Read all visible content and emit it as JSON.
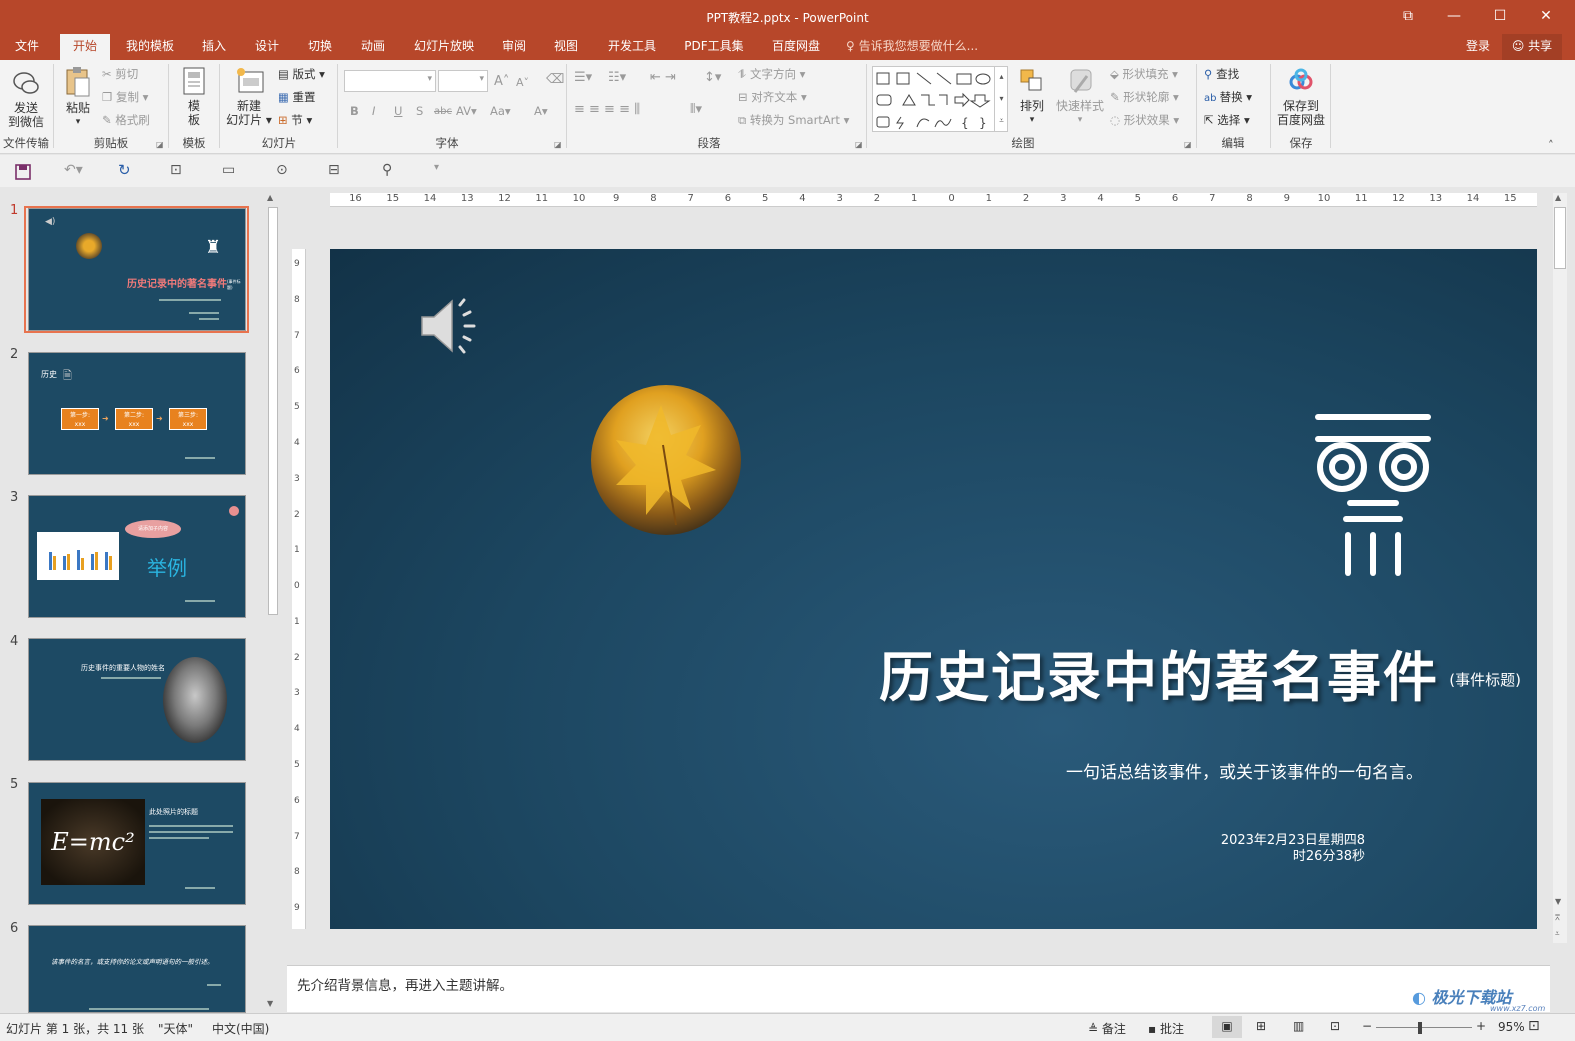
{
  "window": {
    "title": "PPT教程2.pptx - PowerPoint",
    "controls": [
      "⧉",
      "—",
      "☐",
      "✕"
    ]
  },
  "tabs": {
    "file": "文件",
    "items": [
      "开始",
      "我的模板",
      "插入",
      "设计",
      "切换",
      "动画",
      "幻灯片放映",
      "审阅",
      "视图",
      "开发工具",
      "PDF工具集",
      "百度网盘"
    ],
    "tellme": "告诉我您想要做什么...",
    "login": "登录",
    "share": "共享"
  },
  "ribbon": {
    "wechat": {
      "label": "发送到微信",
      "line1": "发送",
      "line2": "到微信",
      "group": "文件传输"
    },
    "clipboard": {
      "paste": "粘贴",
      "cut": "剪切",
      "copy": "复制",
      "painter": "格式刷",
      "group": "剪贴板"
    },
    "template": {
      "label1": "模",
      "label2": "板",
      "group": "模板"
    },
    "slides": {
      "new1": "新建",
      "new2": "幻灯片",
      "layout": "版式",
      "reset": "重置",
      "section": "节",
      "group": "幻灯片"
    },
    "font": {
      "group": "字体",
      "bold": "B",
      "italic": "I",
      "underline": "U",
      "shadow": "S",
      "strike": "abc",
      "spacing": "AV",
      "case": "Aa",
      "grow": "A",
      "shrink": "A",
      "color": "A"
    },
    "paragraph": {
      "textdir": "文字方向",
      "align": "对齐文本",
      "smartart": "转换为 SmartArt",
      "group": "段落"
    },
    "drawing": {
      "arrange": "排列",
      "quickstyle": "快速样式",
      "fill": "形状填充",
      "outline": "形状轮廓",
      "effects": "形状效果",
      "group": "绘图"
    },
    "editing": {
      "find": "查找",
      "replace": "替换",
      "select": "选择",
      "group": "编辑"
    },
    "save": {
      "line1": "保存到",
      "line2": "百度网盘",
      "group": "保存"
    }
  },
  "thumbnails": [
    {
      "num": "1",
      "title": "历史记录中的著名事件",
      "tag": "(事件标题)"
    },
    {
      "num": "2",
      "label": "历史",
      "steps": [
        "第一步:",
        "第二步:",
        "第三步:"
      ],
      "sub": "xxx"
    },
    {
      "num": "3",
      "bubble": "请添加子内容",
      "word": "举例"
    },
    {
      "num": "4",
      "title": "历史事件的重要人物的姓名"
    },
    {
      "num": "5",
      "title": "此处照片的标题",
      "formula": "E=mc²"
    },
    {
      "num": "6",
      "quote": "该事件的名言，或支持你的论文或声明语句的一般引述。"
    }
  ],
  "ruler": {
    "h": [
      "16",
      "15",
      "14",
      "13",
      "12",
      "11",
      "10",
      "9",
      "8",
      "7",
      "6",
      "5",
      "4",
      "3",
      "2",
      "1",
      "0",
      "1",
      "2",
      "3",
      "4",
      "5",
      "6",
      "7",
      "8",
      "9",
      "10",
      "11",
      "12",
      "13",
      "14",
      "15",
      "16"
    ],
    "v": [
      "9",
      "8",
      "7",
      "6",
      "5",
      "4",
      "3",
      "2",
      "1",
      "0",
      "1",
      "2",
      "3",
      "4",
      "5",
      "6",
      "7",
      "8",
      "9"
    ]
  },
  "slide": {
    "title": "历史记录中的著名事件",
    "tag": "(事件标题)",
    "subtitle": "一句话总结该事件，或关于该事件的一句名言。",
    "date_line1": "2023年2月23日星期四8",
    "date_line2": "时26分38秒"
  },
  "notes": {
    "text": "先介绍背景信息，再进入主题讲解。"
  },
  "status": {
    "slide_info": "幻灯片 第 1 张，共 11 张",
    "theme": "\"天体\"",
    "lang": "中文(中国)",
    "notes_btn": "备注",
    "comments_btn": "批注",
    "zoom": "95%",
    "watermark": "极光下载站",
    "watermark_url": "www.xz7.com"
  },
  "colors": {
    "accent": "#b7472a",
    "slide_bg": "#1c4660",
    "selected_thumb": "#e8734e"
  }
}
